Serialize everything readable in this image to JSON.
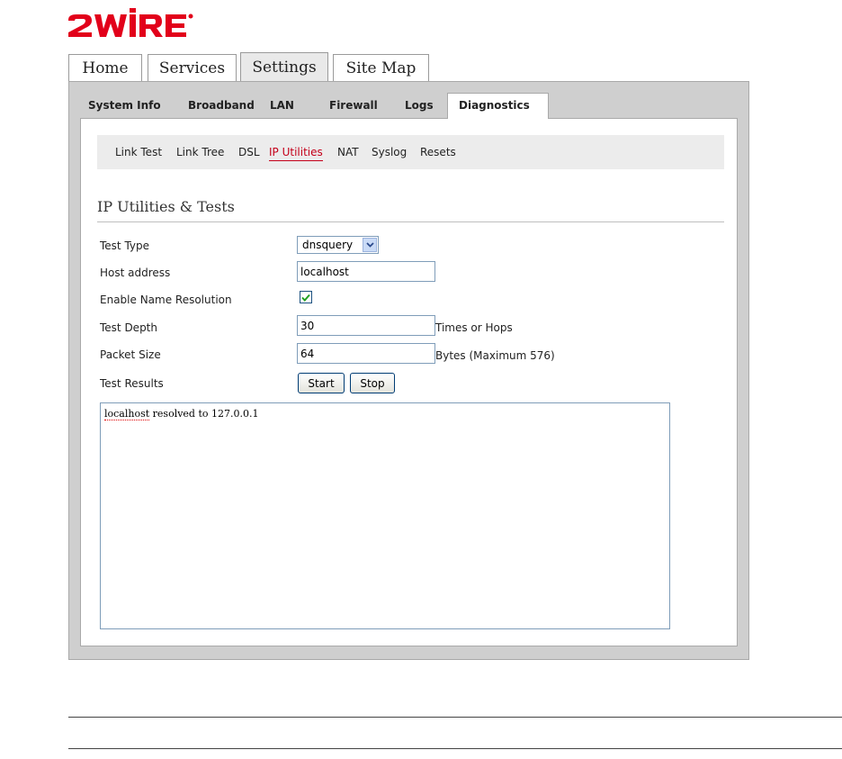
{
  "brand": {
    "name": "2WIRE",
    "color": "#e2001a"
  },
  "top_tabs": [
    {
      "label": "Home"
    },
    {
      "label": "Services"
    },
    {
      "label": "Settings",
      "active": true
    },
    {
      "label": "Site Map"
    }
  ],
  "sub_tabs": [
    {
      "label": "System Info"
    },
    {
      "label": "Broadband"
    },
    {
      "label": "LAN"
    },
    {
      "label": "Firewall"
    },
    {
      "label": "Logs"
    },
    {
      "label": "Diagnostics",
      "active": true
    }
  ],
  "diag_nav": [
    {
      "label": "Link Test"
    },
    {
      "label": "Link Tree"
    },
    {
      "label": "DSL"
    },
    {
      "label": "IP Utilities",
      "active": true
    },
    {
      "label": "NAT"
    },
    {
      "label": "Syslog"
    },
    {
      "label": "Resets"
    }
  ],
  "section": {
    "title": "IP Utilities & Tests"
  },
  "form": {
    "test_type": {
      "label": "Test Type",
      "value": "dnsquery"
    },
    "host_address": {
      "label": "Host address",
      "value": "localhost"
    },
    "name_resolution": {
      "label": "Enable Name Resolution",
      "checked": true
    },
    "test_depth": {
      "label": "Test Depth",
      "value": "30",
      "suffix": "Times or Hops"
    },
    "packet_size": {
      "label": "Packet Size",
      "value": "64",
      "suffix": "Bytes (Maximum 576)"
    },
    "test_results": {
      "label": "Test Results"
    },
    "start_label": "Start",
    "stop_label": "Stop"
  },
  "results": {
    "host": "localhost",
    "rest": " resolved to 127.0.0.1"
  },
  "colors": {
    "accent_red": "#c4001a",
    "frame_gray": "#cfcfcf",
    "nav_gray": "#ececec"
  }
}
